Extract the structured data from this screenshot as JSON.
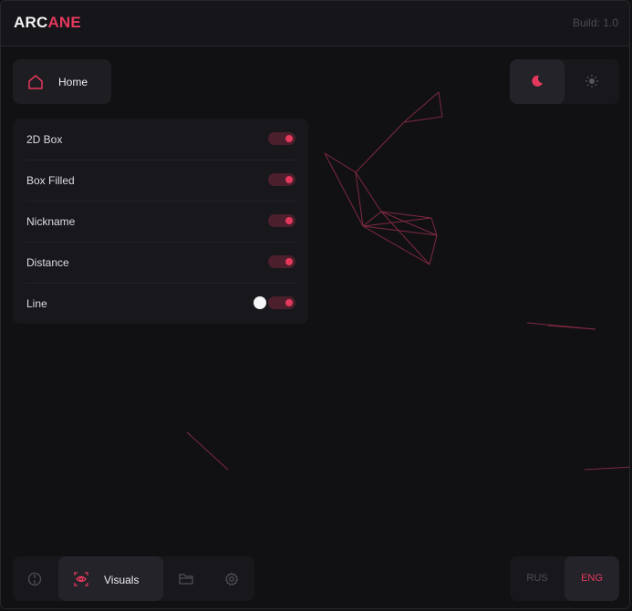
{
  "app": {
    "logo_part1": "ARC",
    "logo_part2": "ANE",
    "build": "Build: 1.0"
  },
  "colors": {
    "accent": "#e5385d",
    "background": "#111114",
    "panel": "#18181c"
  },
  "home": {
    "label": "Home",
    "icon": "home-icon"
  },
  "theme": {
    "dark_icon": "moon-icon",
    "light_icon": "sun-icon",
    "selected": "dark"
  },
  "visuals": {
    "options": [
      {
        "label": "2D Box",
        "enabled": true
      },
      {
        "label": "Box Filled",
        "enabled": true
      },
      {
        "label": "Nickname",
        "enabled": true
      },
      {
        "label": "Distance",
        "enabled": true
      },
      {
        "label": "Line",
        "enabled": true,
        "color": "#ffffff"
      }
    ]
  },
  "nav": {
    "items": [
      {
        "icon": "crosshair-icon"
      },
      {
        "icon": "eye-scan-icon",
        "label": "Visuals",
        "active": true
      },
      {
        "icon": "folder-icon"
      },
      {
        "icon": "gear-icon"
      }
    ]
  },
  "language": {
    "options": [
      "RUS",
      "ENG"
    ],
    "selected": "ENG"
  }
}
